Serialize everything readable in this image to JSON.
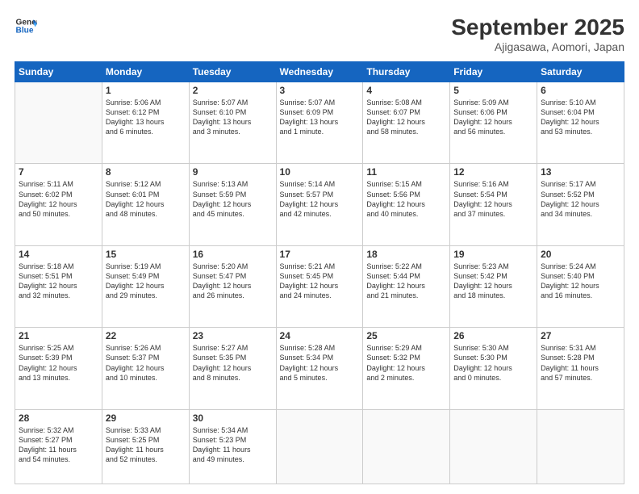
{
  "header": {
    "logo_line1": "General",
    "logo_line2": "Blue",
    "title": "September 2025",
    "subtitle": "Ajigasawa, Aomori, Japan"
  },
  "days_of_week": [
    "Sunday",
    "Monday",
    "Tuesday",
    "Wednesday",
    "Thursday",
    "Friday",
    "Saturday"
  ],
  "weeks": [
    [
      {
        "day": "",
        "text": ""
      },
      {
        "day": "1",
        "text": "Sunrise: 5:06 AM\nSunset: 6:12 PM\nDaylight: 13 hours\nand 6 minutes."
      },
      {
        "day": "2",
        "text": "Sunrise: 5:07 AM\nSunset: 6:10 PM\nDaylight: 13 hours\nand 3 minutes."
      },
      {
        "day": "3",
        "text": "Sunrise: 5:07 AM\nSunset: 6:09 PM\nDaylight: 13 hours\nand 1 minute."
      },
      {
        "day": "4",
        "text": "Sunrise: 5:08 AM\nSunset: 6:07 PM\nDaylight: 12 hours\nand 58 minutes."
      },
      {
        "day": "5",
        "text": "Sunrise: 5:09 AM\nSunset: 6:06 PM\nDaylight: 12 hours\nand 56 minutes."
      },
      {
        "day": "6",
        "text": "Sunrise: 5:10 AM\nSunset: 6:04 PM\nDaylight: 12 hours\nand 53 minutes."
      }
    ],
    [
      {
        "day": "7",
        "text": "Sunrise: 5:11 AM\nSunset: 6:02 PM\nDaylight: 12 hours\nand 50 minutes."
      },
      {
        "day": "8",
        "text": "Sunrise: 5:12 AM\nSunset: 6:01 PM\nDaylight: 12 hours\nand 48 minutes."
      },
      {
        "day": "9",
        "text": "Sunrise: 5:13 AM\nSunset: 5:59 PM\nDaylight: 12 hours\nand 45 minutes."
      },
      {
        "day": "10",
        "text": "Sunrise: 5:14 AM\nSunset: 5:57 PM\nDaylight: 12 hours\nand 42 minutes."
      },
      {
        "day": "11",
        "text": "Sunrise: 5:15 AM\nSunset: 5:56 PM\nDaylight: 12 hours\nand 40 minutes."
      },
      {
        "day": "12",
        "text": "Sunrise: 5:16 AM\nSunset: 5:54 PM\nDaylight: 12 hours\nand 37 minutes."
      },
      {
        "day": "13",
        "text": "Sunrise: 5:17 AM\nSunset: 5:52 PM\nDaylight: 12 hours\nand 34 minutes."
      }
    ],
    [
      {
        "day": "14",
        "text": "Sunrise: 5:18 AM\nSunset: 5:51 PM\nDaylight: 12 hours\nand 32 minutes."
      },
      {
        "day": "15",
        "text": "Sunrise: 5:19 AM\nSunset: 5:49 PM\nDaylight: 12 hours\nand 29 minutes."
      },
      {
        "day": "16",
        "text": "Sunrise: 5:20 AM\nSunset: 5:47 PM\nDaylight: 12 hours\nand 26 minutes."
      },
      {
        "day": "17",
        "text": "Sunrise: 5:21 AM\nSunset: 5:45 PM\nDaylight: 12 hours\nand 24 minutes."
      },
      {
        "day": "18",
        "text": "Sunrise: 5:22 AM\nSunset: 5:44 PM\nDaylight: 12 hours\nand 21 minutes."
      },
      {
        "day": "19",
        "text": "Sunrise: 5:23 AM\nSunset: 5:42 PM\nDaylight: 12 hours\nand 18 minutes."
      },
      {
        "day": "20",
        "text": "Sunrise: 5:24 AM\nSunset: 5:40 PM\nDaylight: 12 hours\nand 16 minutes."
      }
    ],
    [
      {
        "day": "21",
        "text": "Sunrise: 5:25 AM\nSunset: 5:39 PM\nDaylight: 12 hours\nand 13 minutes."
      },
      {
        "day": "22",
        "text": "Sunrise: 5:26 AM\nSunset: 5:37 PM\nDaylight: 12 hours\nand 10 minutes."
      },
      {
        "day": "23",
        "text": "Sunrise: 5:27 AM\nSunset: 5:35 PM\nDaylight: 12 hours\nand 8 minutes."
      },
      {
        "day": "24",
        "text": "Sunrise: 5:28 AM\nSunset: 5:34 PM\nDaylight: 12 hours\nand 5 minutes."
      },
      {
        "day": "25",
        "text": "Sunrise: 5:29 AM\nSunset: 5:32 PM\nDaylight: 12 hours\nand 2 minutes."
      },
      {
        "day": "26",
        "text": "Sunrise: 5:30 AM\nSunset: 5:30 PM\nDaylight: 12 hours\nand 0 minutes."
      },
      {
        "day": "27",
        "text": "Sunrise: 5:31 AM\nSunset: 5:28 PM\nDaylight: 11 hours\nand 57 minutes."
      }
    ],
    [
      {
        "day": "28",
        "text": "Sunrise: 5:32 AM\nSunset: 5:27 PM\nDaylight: 11 hours\nand 54 minutes."
      },
      {
        "day": "29",
        "text": "Sunrise: 5:33 AM\nSunset: 5:25 PM\nDaylight: 11 hours\nand 52 minutes."
      },
      {
        "day": "30",
        "text": "Sunrise: 5:34 AM\nSunset: 5:23 PM\nDaylight: 11 hours\nand 49 minutes."
      },
      {
        "day": "",
        "text": ""
      },
      {
        "day": "",
        "text": ""
      },
      {
        "day": "",
        "text": ""
      },
      {
        "day": "",
        "text": ""
      }
    ]
  ]
}
